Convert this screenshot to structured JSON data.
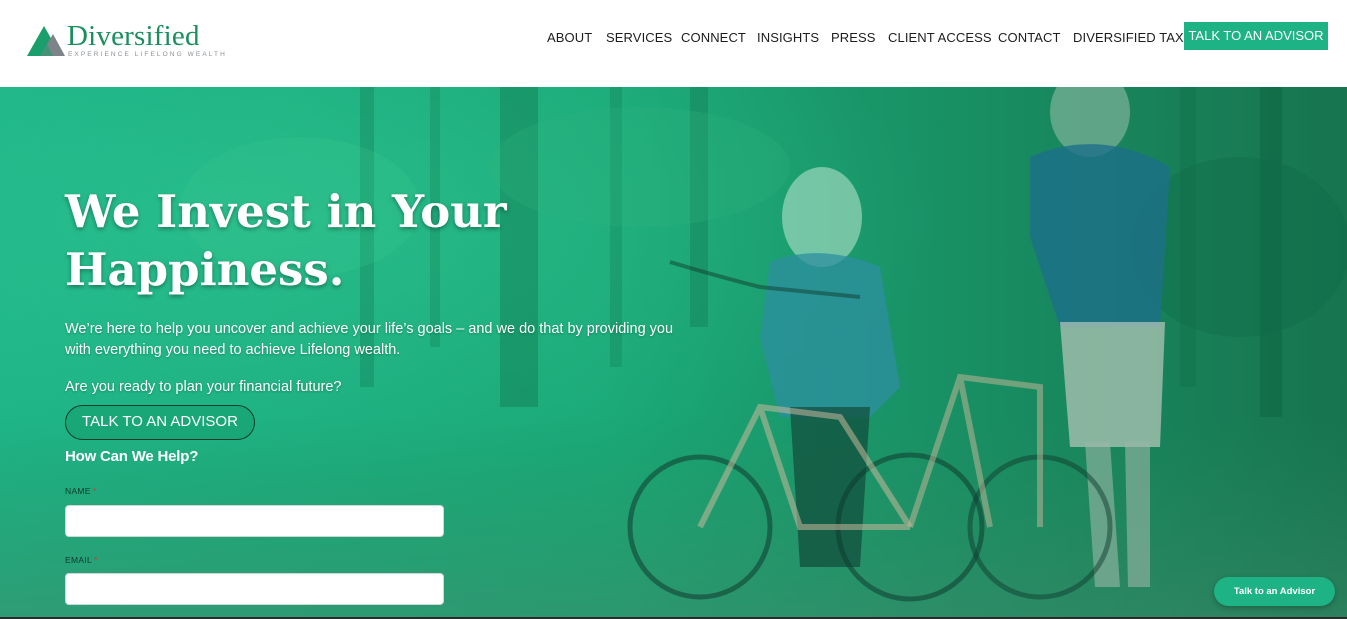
{
  "brand": {
    "name": "Diversified",
    "tagline": "EXPERIENCE LIFELONG WEALTH",
    "primary_color": "#1db385",
    "logo_icon": "triangle-mountain-icon"
  },
  "nav": {
    "items": [
      {
        "label": "ABOUT"
      },
      {
        "label": "SERVICES"
      },
      {
        "label": "CONNECT"
      },
      {
        "label": "INSIGHTS"
      },
      {
        "label": "PRESS"
      },
      {
        "label": "CLIENT ACCESS"
      },
      {
        "label": "CONTACT"
      },
      {
        "label": "DIVERSIFIED TAX"
      }
    ],
    "cta_label": "TALK TO AN ADVISOR"
  },
  "hero": {
    "title": "We Invest in Your Happiness.",
    "text": "We’re here to help you uncover and achieve your life’s goals – and we do that by providing you with everything you need to achieve Lifelong wealth.",
    "question": "Are you ready to plan your financial future?",
    "cta_label": "TALK TO AN ADVISOR",
    "overlay_color": "#1db385"
  },
  "form": {
    "title": "How Can We Help?",
    "fields": [
      {
        "label": "NAME",
        "required_mark": "*",
        "value": ""
      },
      {
        "label": "EMAIL",
        "required_mark": "*",
        "value": ""
      }
    ]
  },
  "floating_cta": {
    "label": "Talk to an Advisor"
  }
}
